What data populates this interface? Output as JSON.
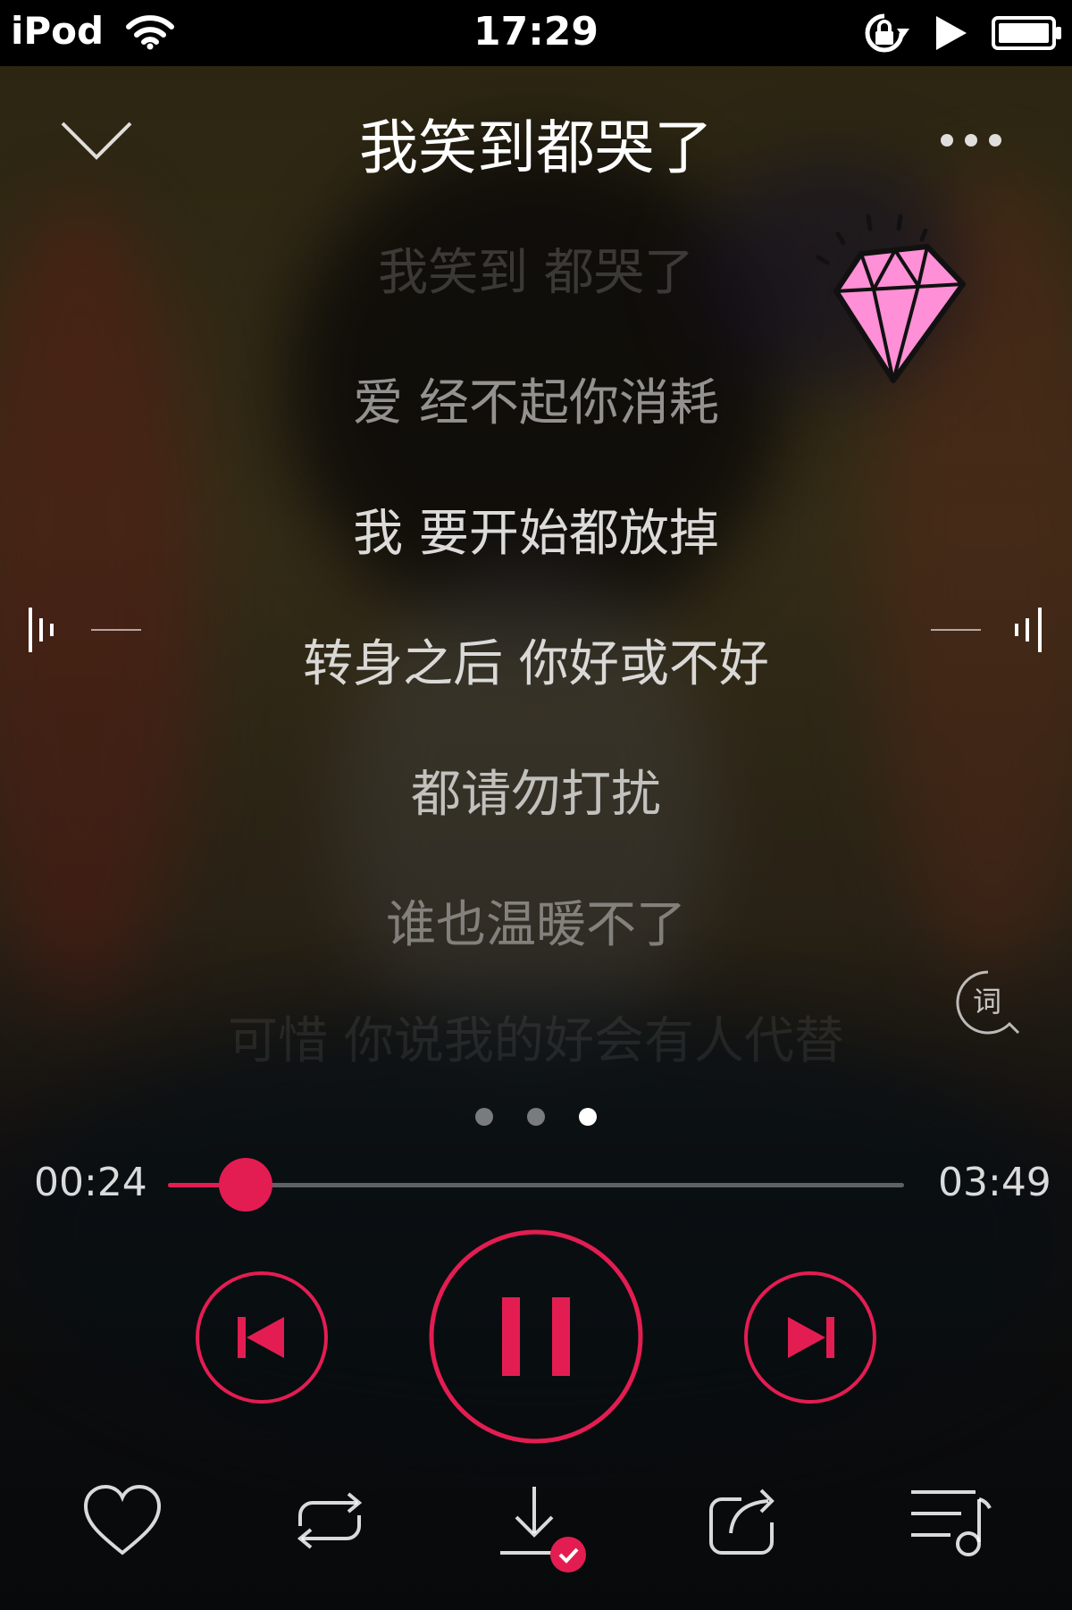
{
  "status_bar": {
    "carrier": "iPod",
    "time": "17:29"
  },
  "header": {
    "title": "我笑到都哭了"
  },
  "lyrics": [
    "我笑到 都哭了",
    "爱 经不起你消耗",
    "我 要开始都放掉",
    "转身之后 你好或不好",
    "都请勿打扰",
    "谁也温暖不了",
    "可惜 你说我的好会有人代替"
  ],
  "lyrics_button": "词",
  "page_dots": {
    "count": 3,
    "active_index": 2
  },
  "progress": {
    "current": "00:24",
    "total": "03:49",
    "fraction": 0.105
  },
  "controls": {
    "prev_icon": "previous-track-icon",
    "play_state_icon": "pause-icon",
    "next_icon": "next-track-icon"
  },
  "toolbar": [
    "heart-icon",
    "repeat-icon",
    "download-done-icon",
    "share-icon",
    "playlist-icon"
  ],
  "colors": {
    "accent": "#e31d52",
    "diamond": "#ff8fd6"
  }
}
